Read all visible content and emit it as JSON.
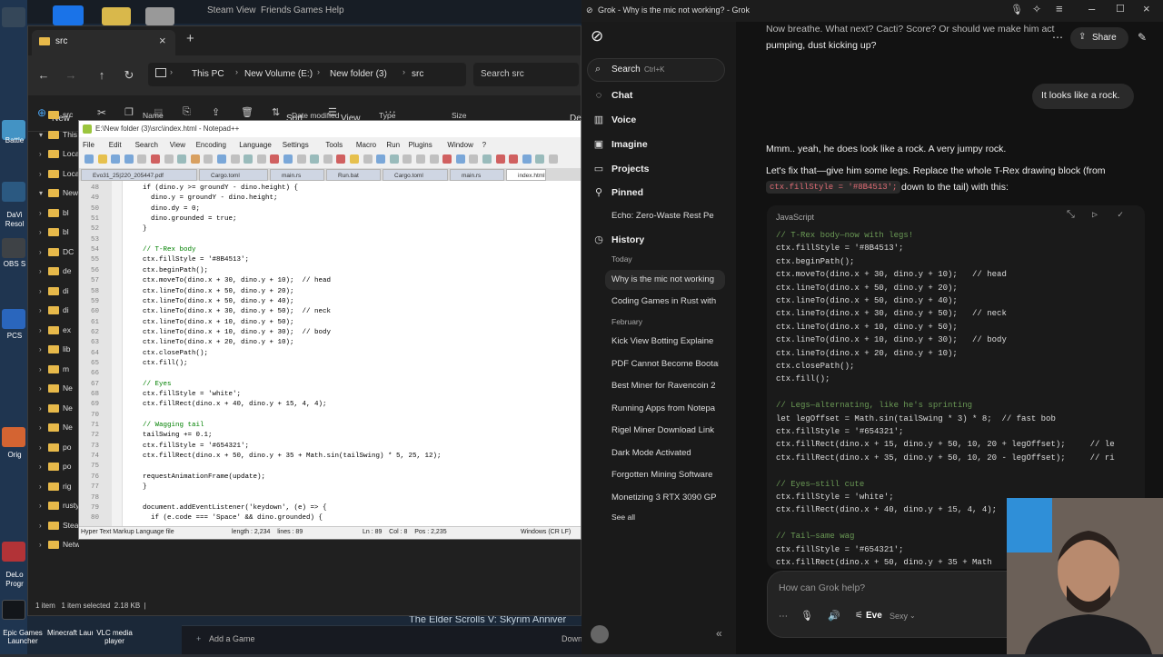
{
  "desktop": {
    "labels": [
      "pictu",
      "Battle",
      "DaVi",
      "Resol",
      "OBS S",
      "PCS",
      "Orig",
      "DeLo",
      "Progr",
      "Epic Games Launcher",
      "Minecraft Launcher",
      "VLC media player"
    ]
  },
  "steam": {
    "menu": [
      "Steam",
      "View",
      "Friends",
      "Games",
      "Help"
    ],
    "game_banner": "The Elder Scrolls V: Skyrim Anniver",
    "add_game": "Add a Game",
    "downloads": "Down"
  },
  "explorer": {
    "tab_title": "src",
    "breadcrumb": [
      "This PC",
      "New Volume (E:)",
      "New folder (3)",
      "src"
    ],
    "search_placeholder": "Search src",
    "toolbar": {
      "new": "New",
      "sort": "Sort",
      "view": "View",
      "details": "Det"
    },
    "columns": [
      "Name",
      "Date modified",
      "Type",
      "Size"
    ],
    "tree": [
      {
        "label": "src",
        "chev": "",
        "expanded": false
      },
      {
        "label": "This",
        "chev": "▾"
      },
      {
        "label": "Loca",
        "chev": "›"
      },
      {
        "label": "Loca",
        "chev": "›"
      },
      {
        "label": "New",
        "chev": "▾"
      },
      {
        "label": "bl",
        "chev": "›"
      },
      {
        "label": "bl",
        "chev": "›"
      },
      {
        "label": "DC",
        "chev": "›"
      },
      {
        "label": "de",
        "chev": "›"
      },
      {
        "label": "di",
        "chev": "›"
      },
      {
        "label": "di",
        "chev": "›"
      },
      {
        "label": "ex",
        "chev": "›"
      },
      {
        "label": "lib",
        "chev": "›"
      },
      {
        "label": "m",
        "chev": "›"
      },
      {
        "label": "Ne",
        "chev": "›"
      },
      {
        "label": "Ne",
        "chev": "›"
      },
      {
        "label": "Ne",
        "chev": "›"
      },
      {
        "label": "po",
        "chev": "›"
      },
      {
        "label": "po",
        "chev": "›"
      },
      {
        "label": "rig",
        "chev": "›"
      },
      {
        "label": "rustyboy",
        "chev": "›"
      },
      {
        "label": "SteamLibrary",
        "chev": "›"
      },
      {
        "label": "Network",
        "chev": "›"
      }
    ],
    "status": "1 item   1 item selected  2.18 KB  |"
  },
  "npp": {
    "title": "E:\\New folder (3)\\src\\index.html - Notepad++",
    "menu": [
      "File",
      "Edit",
      "Search",
      "View",
      "Encoding",
      "Language",
      "Settings",
      "Tools",
      "Macro",
      "Run",
      "Plugins",
      "Window",
      "?"
    ],
    "tabs": [
      "Evo31_25|220_205447.pdf",
      "Cargo.toml",
      "main.rs",
      "Run.bat",
      "Cargo.toml",
      "main.rs",
      "index.html"
    ],
    "lines": [
      {
        "n": "48",
        "t": "if (dino.y >= groundY - dino.height) {",
        "c": ""
      },
      {
        "n": "49",
        "t": "  dino.y = groundY - dino.height;",
        "c": ""
      },
      {
        "n": "50",
        "t": "  dino.dy = 0;",
        "c": ""
      },
      {
        "n": "51",
        "t": "  dino.grounded = true;",
        "c": ""
      },
      {
        "n": "52",
        "t": "}",
        "c": ""
      },
      {
        "n": "53",
        "t": "",
        "c": ""
      },
      {
        "n": "54",
        "t": "// T-Rex body",
        "c": "cm"
      },
      {
        "n": "55",
        "t": "ctx.fillStyle = '#8B4513';",
        "c": ""
      },
      {
        "n": "56",
        "t": "ctx.beginPath();",
        "c": ""
      },
      {
        "n": "57",
        "t": "ctx.moveTo(dino.x + 30, dino.y + 10);  // head",
        "c": ""
      },
      {
        "n": "58",
        "t": "ctx.lineTo(dino.x + 50, dino.y + 20);",
        "c": ""
      },
      {
        "n": "59",
        "t": "ctx.lineTo(dino.x + 50, dino.y + 40);",
        "c": ""
      },
      {
        "n": "60",
        "t": "ctx.lineTo(dino.x + 30, dino.y + 50);  // neck",
        "c": ""
      },
      {
        "n": "61",
        "t": "ctx.lineTo(dino.x + 10, dino.y + 50);",
        "c": ""
      },
      {
        "n": "62",
        "t": "ctx.lineTo(dino.x + 10, dino.y + 30);  // body",
        "c": ""
      },
      {
        "n": "63",
        "t": "ctx.lineTo(dino.x + 20, dino.y + 10);",
        "c": ""
      },
      {
        "n": "64",
        "t": "ctx.closePath();",
        "c": ""
      },
      {
        "n": "65",
        "t": "ctx.fill();",
        "c": ""
      },
      {
        "n": "66",
        "t": "",
        "c": ""
      },
      {
        "n": "67",
        "t": "// Eyes",
        "c": "cm"
      },
      {
        "n": "68",
        "t": "ctx.fillStyle = 'white';",
        "c": ""
      },
      {
        "n": "69",
        "t": "ctx.fillRect(dino.x + 40, dino.y + 15, 4, 4);",
        "c": ""
      },
      {
        "n": "70",
        "t": "",
        "c": ""
      },
      {
        "n": "71",
        "t": "// Wagging tail",
        "c": "cm"
      },
      {
        "n": "72",
        "t": "tailSwing += 0.1;",
        "c": ""
      },
      {
        "n": "73",
        "t": "ctx.fillStyle = '#654321';",
        "c": ""
      },
      {
        "n": "74",
        "t": "ctx.fillRect(dino.x + 50, dino.y + 35 + Math.sin(tailSwing) * 5, 25, 12);",
        "c": ""
      },
      {
        "n": "75",
        "t": "",
        "c": ""
      },
      {
        "n": "76",
        "t": "requestAnimationFrame(update);",
        "c": ""
      },
      {
        "n": "77",
        "t": "}",
        "c": ""
      },
      {
        "n": "78",
        "t": "",
        "c": ""
      },
      {
        "n": "79",
        "t": "document.addEventListener('keydown', (e) => {",
        "c": ""
      },
      {
        "n": "80",
        "t": "  if (e.code === 'Space' && dino.grounded) {",
        "c": ""
      }
    ],
    "status": {
      "lang": "Hyper Text Markup Language file",
      "length": "length : 2,234    lines : 89",
      "pos": "Ln : 89    Col : 8    Pos : 2,235",
      "eol": "Windows (CR LF)"
    }
  },
  "grok": {
    "window_title": "Grok - Why is the mic not working? - Grok",
    "search_label": "Search",
    "search_shortcut": "Ctrl+K",
    "nav": [
      "Chat",
      "Voice",
      "Imagine",
      "Projects",
      "Pinned"
    ],
    "pinned_item": "Echo: Zero-Waste Rest Pe",
    "history_label": "History",
    "today_label": "Today",
    "today_items": [
      "Why is the mic not working",
      "Coding Games in Rust with"
    ],
    "february_label": "February",
    "february_items": [
      "Kick View Botting Explaine",
      "PDF Cannot Become Bootab",
      "Best Miner for Ravencoin 2",
      "Running Apps from Notepa",
      "Rigel Miner Download Link",
      "Dark Mode Activated",
      "Forgotten Mining Software",
      "Monetizing 3 RTX 3090 GP"
    ],
    "see_all": "See all",
    "share": "Share",
    "top_text_1": "Now breathe. What next? Cacti? Score? Or should we make him act",
    "top_text_2": "pumping, dust kicking up?",
    "user_bubble": "It looks like a rock.",
    "reply_1": "Mmm.. yeah, he does look like a rock. A very jumpy rock.",
    "reply_2": "Let's fix that—give him some legs. Replace the whole T-Rex drawing block (from",
    "reply_code_a": "ctx.fillStyle = '#8B4513';",
    "reply_3": "down to the tail) with this:",
    "code_lang": "JavaScript",
    "code": [
      {
        "t": "// T-Rex body—now with legs!",
        "c": "cm2"
      },
      {
        "t": "ctx.fillStyle = '#8B4513';",
        "c": ""
      },
      {
        "t": "ctx.beginPath();",
        "c": ""
      },
      {
        "t": "ctx.moveTo(dino.x + 30, dino.y + 10);   // head",
        "c": ""
      },
      {
        "t": "ctx.lineTo(dino.x + 50, dino.y + 20);",
        "c": ""
      },
      {
        "t": "ctx.lineTo(dino.x + 50, dino.y + 40);",
        "c": ""
      },
      {
        "t": "ctx.lineTo(dino.x + 30, dino.y + 50);   // neck",
        "c": ""
      },
      {
        "t": "ctx.lineTo(dino.x + 10, dino.y + 50);",
        "c": ""
      },
      {
        "t": "ctx.lineTo(dino.x + 10, dino.y + 30);   // body",
        "c": ""
      },
      {
        "t": "ctx.lineTo(dino.x + 20, dino.y + 10);",
        "c": ""
      },
      {
        "t": "ctx.closePath();",
        "c": ""
      },
      {
        "t": "ctx.fill();",
        "c": ""
      },
      {
        "t": "",
        "c": ""
      },
      {
        "t": "// Legs—alternating, like he's sprinting",
        "c": "cm2"
      },
      {
        "t": "let legOffset = Math.sin(tailSwing * 3) * 8;  // fast bob",
        "c": ""
      },
      {
        "t": "ctx.fillStyle = '#654321';",
        "c": ""
      },
      {
        "t": "ctx.fillRect(dino.x + 15, dino.y + 50, 10, 20 + legOffset);     // le",
        "c": ""
      },
      {
        "t": "ctx.fillRect(dino.x + 35, dino.y + 50, 10, 20 - legOffset);     // ri",
        "c": ""
      },
      {
        "t": "",
        "c": ""
      },
      {
        "t": "// Eyes—still cute",
        "c": "cm2"
      },
      {
        "t": "ctx.fillStyle = 'white';",
        "c": ""
      },
      {
        "t": "ctx.fillRect(dino.x + 40, dino.y + 15, 4, 4);",
        "c": ""
      },
      {
        "t": "",
        "c": ""
      },
      {
        "t": "// Tail—same wag",
        "c": "cm2"
      },
      {
        "t": "ctx.fillStyle = '#654321';",
        "c": ""
      },
      {
        "t": "ctx.fillRect(dino.x + 50, dino.y + 35 + Math",
        "c": ""
      }
    ],
    "input_placeholder": "How can Grok help?",
    "voice_name": "Eve",
    "voice_style": "Sexy"
  },
  "colors": {
    "grok_bg": "#121212",
    "npp_comment": "#008000",
    "steam_bg": "#1b2838"
  }
}
